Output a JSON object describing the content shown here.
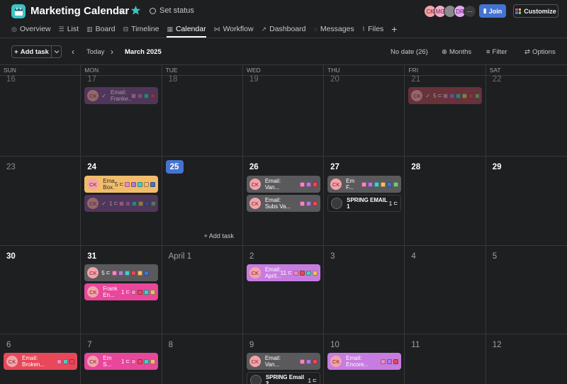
{
  "header": {
    "title": "Marketing Calendar",
    "set_status": "Set status",
    "join_label": "Join",
    "customize_label": "Customize",
    "avatars": [
      {
        "initials": "CK",
        "color": "#f5a3a8",
        "text": "#6a2a2e"
      },
      {
        "initials": "MG",
        "color": "#f2a8c9",
        "text": "#6a2a48"
      },
      {
        "initials": "",
        "color": "#8a8a8a",
        "text": "#ffffff"
      },
      {
        "initials": "DR",
        "color": "#e3a7f0",
        "text": "#5a2a66"
      },
      {
        "initials": "···",
        "color": "#3a3a3d",
        "text": "#ffffff"
      }
    ]
  },
  "tabs": [
    {
      "label": "Overview",
      "icon": "overview-icon"
    },
    {
      "label": "List",
      "icon": "list-icon"
    },
    {
      "label": "Board",
      "icon": "board-icon"
    },
    {
      "label": "Timeline",
      "icon": "timeline-icon"
    },
    {
      "label": "Calendar",
      "icon": "calendar-icon",
      "active": true
    },
    {
      "label": "Workflow",
      "icon": "workflow-icon"
    },
    {
      "label": "Dashboard",
      "icon": "dashboard-icon"
    },
    {
      "label": "Messages",
      "icon": "messages-icon"
    },
    {
      "label": "Files",
      "icon": "files-icon"
    }
  ],
  "toolbar": {
    "add_task": "Add task",
    "today": "Today",
    "month": "March 2025",
    "no_date": "No date (26)",
    "months": "Months",
    "filter": "Filter",
    "options": "Options"
  },
  "days_of_week": [
    "SUN",
    "MON",
    "TUE",
    "WED",
    "THU",
    "FRI",
    "SAT"
  ],
  "weeks": [
    {
      "days": [
        "16",
        "17",
        "18",
        "19",
        "20",
        "21",
        "22"
      ]
    },
    {
      "days": [
        "23",
        "24",
        "25",
        "26",
        "27",
        "28",
        "29"
      ]
    },
    {
      "days": [
        "30",
        "31",
        "April 1",
        "2",
        "3",
        "4",
        "5"
      ]
    },
    {
      "days": [
        "6",
        "7",
        "8",
        "9",
        "10",
        "11",
        "12"
      ]
    }
  ],
  "add_task_hint": "+ Add task",
  "tasks": {
    "w1_mon": {
      "initials": "CK",
      "text": "Email: Franke...",
      "color": "#7b4a8c",
      "check": "✓"
    },
    "w1_fri": {
      "initials": "CK",
      "check": "✓",
      "count": "5",
      "color": "#a34350"
    },
    "w2_mon_a": {
      "initials": "CK",
      "text": "Email: Box...",
      "count": "5",
      "color": "#f1bd6c"
    },
    "w2_mon_b": {
      "initials": "CK",
      "check": "✓",
      "count": "1",
      "color": "#7b4a8c"
    },
    "w2_wed_a": {
      "initials": "CK",
      "text": "Email: Van...",
      "color": "#5a5a5d"
    },
    "w2_wed_b": {
      "initials": "CK",
      "text": "Email: Subs Va...",
      "color": "#5a5a5d"
    },
    "w2_thu_a": {
      "initials": "CK",
      "text": "Em F...",
      "color": "#5a5a5d"
    },
    "w2_thu_b": {
      "initials": "",
      "text": "SPRING EMAIL 1",
      "count": "1",
      "color": "#1e1f21"
    },
    "w3_mon_a": {
      "initials": "CK",
      "count": "5",
      "color": "#5a5a5d"
    },
    "w3_mon_b": {
      "initials": "CK",
      "text": "Frank En...",
      "count": "1",
      "color": "#e8479c"
    },
    "w3_wed": {
      "initials": "CK",
      "text": "Email: April...",
      "count": "11",
      "color": "#c77de0"
    },
    "w4_sun": {
      "initials": "CK",
      "text": "Email: Broken...",
      "color": "#e8485a"
    },
    "w4_mon": {
      "initials": "CK",
      "text": "Em S...",
      "count": "1",
      "color": "#e8479c"
    },
    "w4_wed_a": {
      "initials": "CK",
      "text": "Email: Van...",
      "color": "#5a5a5d"
    },
    "w4_wed_b": {
      "initials": "",
      "text": "SPRING Email 2",
      "count": "1",
      "color": "#1e1f21"
    },
    "w4_thu": {
      "initials": "CK",
      "text": "Email: Encore...",
      "color": "#c77de0"
    }
  },
  "colors": {
    "brand": "#3ec3c3",
    "accent": "#4573d2",
    "tag_pink": "#f08ac0",
    "tag_purple": "#b57ad8",
    "tag_teal": "#4ecbc4",
    "tag_red": "#e8485a",
    "tag_yellow": "#f1bd6c",
    "tag_blue": "#4573d2",
    "tag_green": "#7fc47a"
  }
}
